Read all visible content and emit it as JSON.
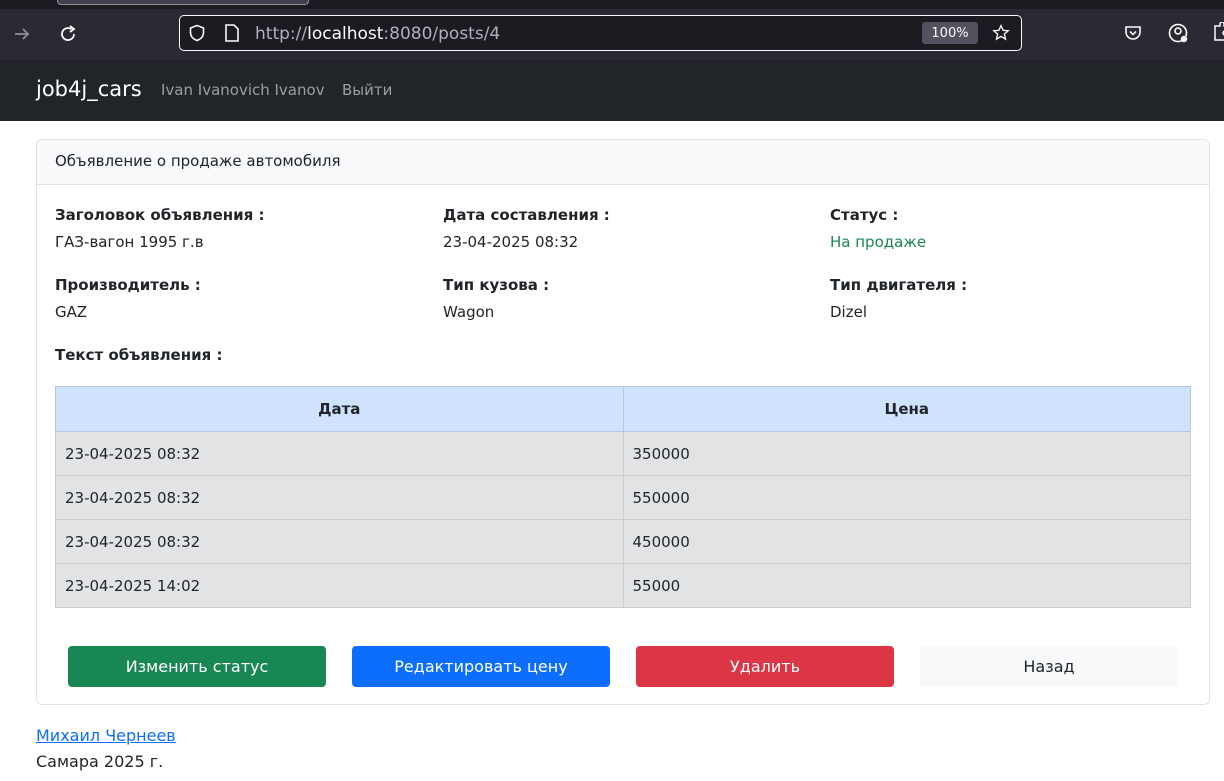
{
  "browser": {
    "url_scheme": "http://",
    "url_host": "localhost",
    "url_rest": ":8080/posts/4",
    "zoom": "100%"
  },
  "navbar": {
    "brand": "job4j_cars",
    "user": "Ivan Ivanovich Ivanov",
    "logout": "Выйти"
  },
  "card": {
    "header": "Объявление о продаже автомобиля",
    "fields": [
      {
        "label": "Заголовок объявления :",
        "value": "ГАЗ-вагон 1995 г.в"
      },
      {
        "label": "Дата составления :",
        "value": "23-04-2025 08:32"
      },
      {
        "label": "Статус :",
        "value": "На продаже"
      },
      {
        "label": "Производитель :",
        "value": "GAZ"
      },
      {
        "label": "Тип кузова :",
        "value": "Wagon"
      },
      {
        "label": "Тип двигателя :",
        "value": "Dizel"
      }
    ],
    "text_label": "Текст объявления :",
    "status_color": "#198754"
  },
  "price_history": {
    "columns": [
      "Дата",
      "Цена"
    ],
    "rows": [
      {
        "date": "23-04-2025 08:32",
        "price": "350000"
      },
      {
        "date": "23-04-2025 08:32",
        "price": "550000"
      },
      {
        "date": "23-04-2025 08:32",
        "price": "450000"
      },
      {
        "date": "23-04-2025 14:02",
        "price": "55000"
      }
    ]
  },
  "actions": {
    "change_status": "Изменить статус",
    "edit_price": "Редактировать цену",
    "delete": "Удалить",
    "back": "Назад",
    "colors": {
      "success": "#198754",
      "primary": "#0d6efd",
      "danger": "#dc3545",
      "light": "#f8f9fa"
    }
  },
  "footer": {
    "author": "Михаил Чернеев",
    "place_year": "Самара 2025 г."
  },
  "icons": [
    "forward-icon",
    "reload-icon",
    "shield-icon",
    "page-icon",
    "star-icon",
    "pocket-icon",
    "account-icon",
    "extensions-icon"
  ]
}
